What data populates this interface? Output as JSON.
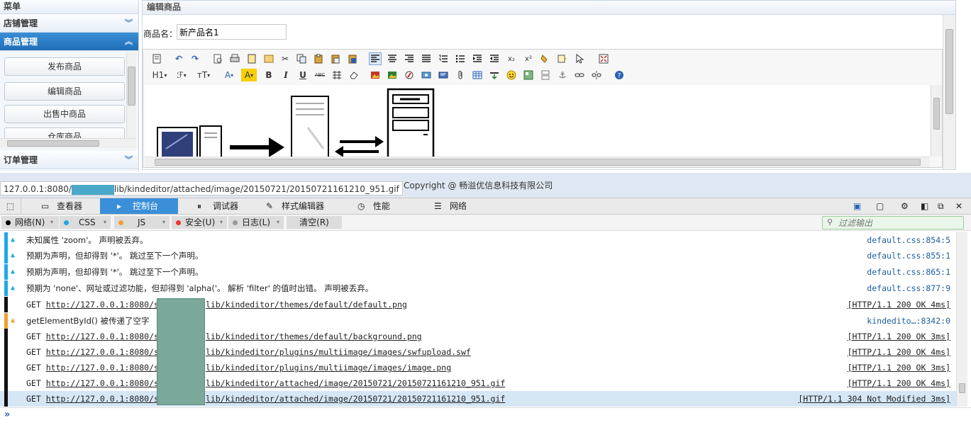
{
  "menu": {
    "title": "菜单",
    "sections": [
      {
        "label": "店铺管理"
      },
      {
        "label": "商品管理"
      },
      {
        "label": "订单管理"
      }
    ],
    "items": [
      "发布商品",
      "编辑商品",
      "出售中商品",
      "仓库商品"
    ]
  },
  "editor": {
    "title": "编辑商品",
    "name_label": "商品名：",
    "name_value": "新产品名1",
    "row2": {
      "h1": "H1",
      "font": "ℱ",
      "size": "тT",
      "textcolor": "A",
      "bgcolor": "A",
      "bold": "B",
      "italic": "I",
      "underline": "U",
      "strike": "ABC"
    }
  },
  "footer": {
    "url_prefix": "127.0.0.1:8080/",
    "url_suffix": "lib/kindeditor/attached/image/20150721/20150721161210_951.gif",
    "copyright": "Copyright @ 畅溢优信息科技有限公司"
  },
  "devtools": {
    "tabs": [
      "查看器",
      "控制台",
      "调试器",
      "样式编辑器",
      "性能",
      "网络"
    ],
    "filters": [
      "网络(N)",
      "CSS",
      "JS",
      "安全(U)",
      "日志(L)"
    ],
    "clear": "清空(R)",
    "filter_placeholder": "过滤输出",
    "colors": {
      "accent": "#3b8fd9",
      "warn": "#f0a030",
      "info": "#1fa8e8"
    },
    "logs": [
      {
        "kind": "css",
        "msg": "未知属性 'zoom'。  声明被丢弃。",
        "src": "default.css:854:5"
      },
      {
        "kind": "css",
        "msg": "预期为声明，但却得到 '*'。  跳过至下一个声明。",
        "src": "default.css:855:1"
      },
      {
        "kind": "css",
        "msg": "预期为声明，但却得到 '*'。  跳过至下一个声明。",
        "src": "default.css:865:1"
      },
      {
        "kind": "css",
        "msg": "预期为 'none'、网址或过滤功能，但却得到 'alpha('。  解析 'filter' 的值时出错。  声明被丢弃。",
        "src": "default.css:877:9"
      },
      {
        "kind": "net",
        "pre": "GET ",
        "url_a": "http://127.0.0.1:8080/s",
        "url_b": "lib/kindeditor/themes/default/default.png",
        "src": "[HTTP/1.1 200 OK 4ms]"
      },
      {
        "kind": "js",
        "msg": "getElementById() 被传递了空字",
        "src": "kindedito…:8342:0"
      },
      {
        "kind": "net",
        "pre": "GET ",
        "url_a": "http://127.0.0.1:8080/s",
        "url_b": "lib/kindeditor/themes/default/background.png",
        "src": "[HTTP/1.1 200 OK 3ms]"
      },
      {
        "kind": "net",
        "pre": "GET ",
        "url_a": "http://127.0.0.1:8080/s",
        "url_b": "lib/kindeditor/plugins/multiimage/images/swfupload.swf",
        "src": "[HTTP/1.1 200 OK 4ms]"
      },
      {
        "kind": "net",
        "pre": "GET ",
        "url_a": "http://127.0.0.1:8080/s",
        "url_b": "lib/kindeditor/plugins/multiimage/images/image.png",
        "src": "[HTTP/1.1 200 OK 3ms]"
      },
      {
        "kind": "net",
        "pre": "GET ",
        "url_a": "http://127.0.0.1:8080/s",
        "url_b": "lib/kindeditor/attached/image/20150721/20150721161210_951.gif",
        "src": "[HTTP/1.1 200 OK 4ms]"
      },
      {
        "kind": "net",
        "pre": "GET ",
        "url_a": "http://127.0.0.1:8080/s",
        "url_b": "lib/kindeditor/attached/image/20150721/20150721161210_951.gif",
        "src": "[HTTP/1.1 304 Not Modified 3ms]"
      }
    ],
    "prompt": "»"
  }
}
